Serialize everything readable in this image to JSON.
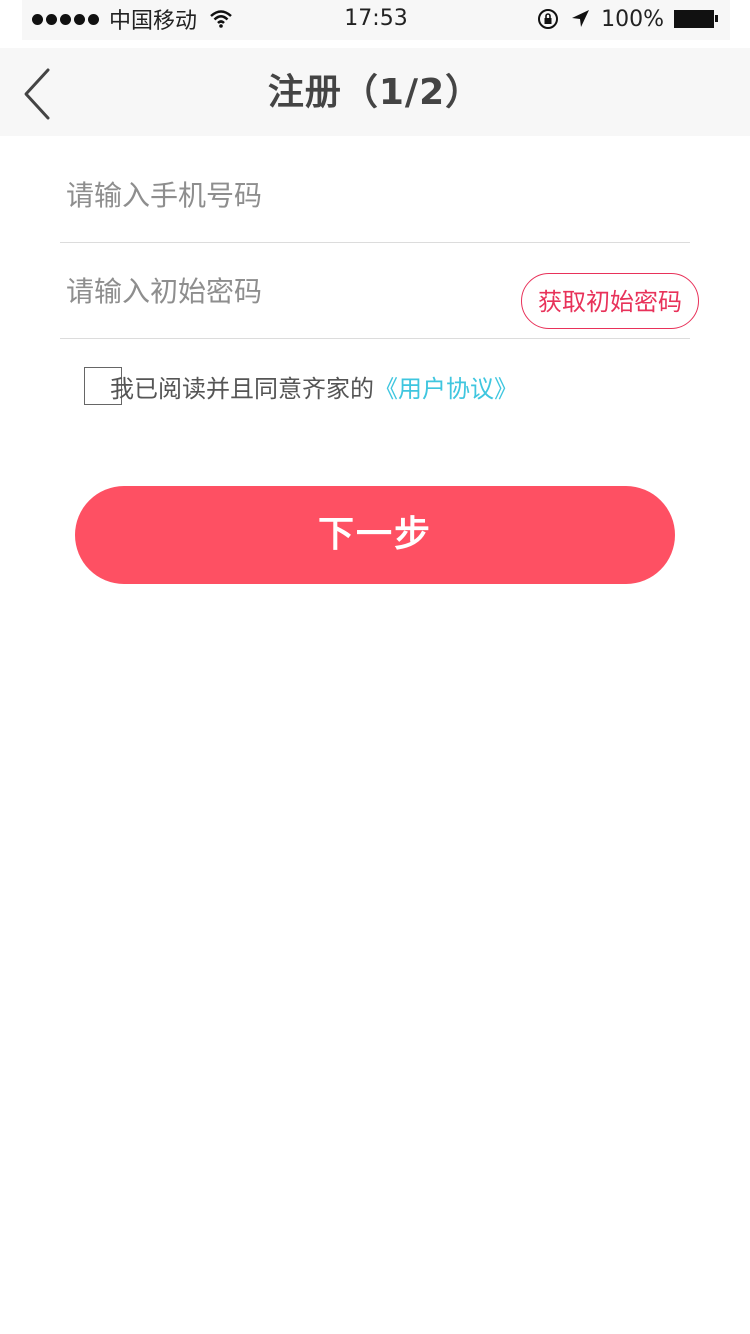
{
  "status_bar": {
    "carrier": "中国移动",
    "time": "17:53",
    "battery": "100%",
    "icons": [
      "signal-icon",
      "wifi-icon",
      "orientation-lock-icon",
      "location-icon",
      "battery-icon"
    ]
  },
  "nav": {
    "title": "注册（1/2）",
    "back_icon": "chevron-left-icon"
  },
  "form": {
    "phone_placeholder": "请输入手机号码",
    "phone_value": "",
    "password_placeholder": "请输入初始密码",
    "password_value": "",
    "get_password_label": "获取初始密码"
  },
  "agreement": {
    "checked": false,
    "text": "我已阅读并且同意齐家的",
    "link_text": "《用户协议》"
  },
  "next_button_label": "下一步",
  "colors": {
    "accent": "#fe5063",
    "link": "#3fc6df",
    "outline_button": "#e8325a",
    "nav_background": "#f7f7f7"
  }
}
